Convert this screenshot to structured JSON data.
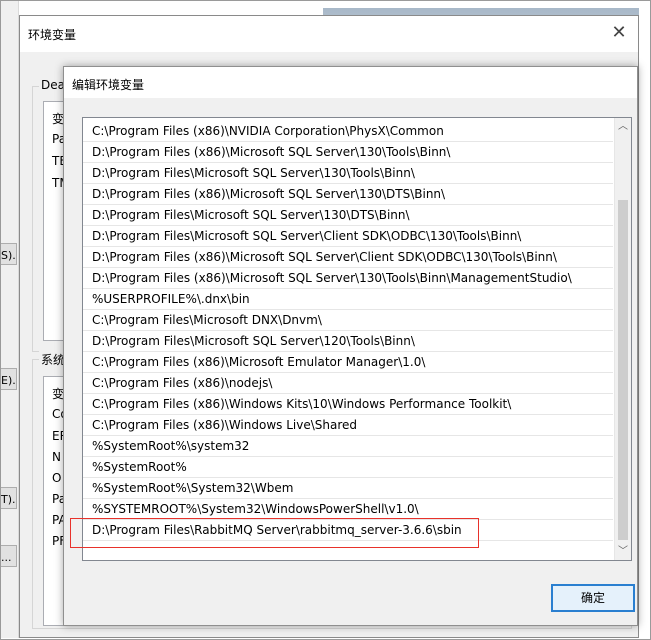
{
  "env_dialog": {
    "title": "环境变量",
    "user_group_label": "Dea",
    "user_list_rows": [
      "变",
      "Pa",
      "TE",
      "TM"
    ],
    "system_group_label": "系统",
    "system_list_rows": [
      "变",
      "Co",
      "ER",
      "N",
      "O",
      "Pa",
      "PA",
      "PF"
    ]
  },
  "bg_left_labels": [
    "S).",
    "E).",
    "T).",
    "..."
  ],
  "edit_dialog": {
    "title": "编辑环境变量",
    "paths": [
      "C:\\Program Files (x86)\\NVIDIA Corporation\\PhysX\\Common",
      "D:\\Program Files (x86)\\Microsoft SQL Server\\130\\Tools\\Binn\\",
      "D:\\Program Files\\Microsoft SQL Server\\130\\Tools\\Binn\\",
      "D:\\Program Files (x86)\\Microsoft SQL Server\\130\\DTS\\Binn\\",
      "D:\\Program Files\\Microsoft SQL Server\\130\\DTS\\Binn\\",
      "D:\\Program Files\\Microsoft SQL Server\\Client SDK\\ODBC\\130\\Tools\\Binn\\",
      "D:\\Program Files (x86)\\Microsoft SQL Server\\Client SDK\\ODBC\\130\\Tools\\Binn\\",
      "D:\\Program Files (x86)\\Microsoft SQL Server\\130\\Tools\\Binn\\ManagementStudio\\",
      "%USERPROFILE%\\.dnx\\bin",
      "C:\\Program Files\\Microsoft DNX\\Dnvm\\",
      "D:\\Program Files\\Microsoft SQL Server\\120\\Tools\\Binn\\",
      "C:\\Program Files (x86)\\Microsoft Emulator Manager\\1.0\\",
      "C:\\Program Files (x86)\\nodejs\\",
      "C:\\Program Files (x86)\\Windows Kits\\10\\Windows Performance Toolkit\\",
      "C:\\Program Files (x86)\\Windows Live\\Shared",
      "%SystemRoot%\\system32",
      "%SystemRoot%",
      "%SystemRoot%\\System32\\Wbem",
      "%SYSTEMROOT%\\System32\\WindowsPowerShell\\v1.0\\",
      "D:\\Program Files\\RabbitMQ Server\\rabbitmq_server-3.6.6\\sbin"
    ],
    "ok_label": "确定"
  },
  "icons": {
    "close": "close-icon",
    "scroll_up": "chevron-up-icon",
    "scroll_down": "chevron-down-icon"
  },
  "colors": {
    "highlight": "#e8322b",
    "button_border": "#2a7fd0"
  }
}
